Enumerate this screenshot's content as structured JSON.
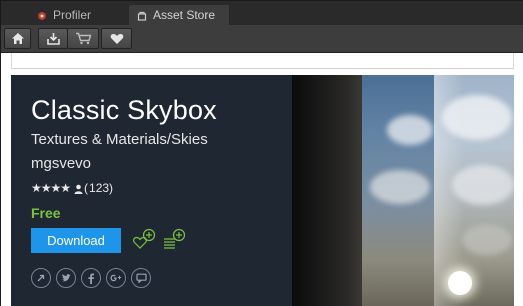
{
  "tabs": [
    {
      "label": "Profiler",
      "active": false
    },
    {
      "label": "Asset Store",
      "active": true
    }
  ],
  "toolbar": {
    "buttons": [
      "home-icon",
      "downloads-icon",
      "cart-icon",
      "heart-icon"
    ]
  },
  "asset": {
    "title": "Classic Skybox",
    "category": "Textures & Materials/Skies",
    "publisher": "mgsvevo",
    "stars": "★★★★",
    "rating_count": "( 123)",
    "price": "Free",
    "download_label": "Download"
  },
  "colors": {
    "price_green": "#7cc242",
    "download_blue": "#1e95e8",
    "banner_bg": "#1f2733"
  },
  "socials": [
    "share-icon",
    "twitter-icon",
    "facebook-icon",
    "google-plus-icon",
    "comment-icon"
  ]
}
